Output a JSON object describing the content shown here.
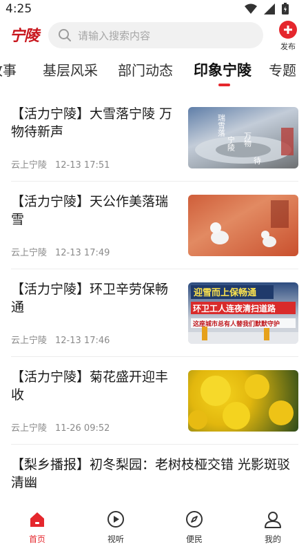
{
  "status_bar": {
    "time": "4:25"
  },
  "header": {
    "logo_text": "宁陵",
    "search_placeholder": "请输入搜索内容",
    "publish_label": "发布"
  },
  "tabs": [
    "故事",
    "基层风采",
    "部门动态",
    "印象宁陵",
    "专题"
  ],
  "active_tab": "印象宁陵",
  "news": [
    {
      "title": "【活力宁陵】大雪落宁陵 万物待新声",
      "source": "云上宁陵",
      "time": "12-13 17:51"
    },
    {
      "title": "【活力宁陵】天公作美落瑞雪",
      "source": "云上宁陵",
      "time": "12-13 17:49"
    },
    {
      "title": "【活力宁陵】环卫辛劳保畅通",
      "source": "云上宁陵",
      "time": "12-13 17:46"
    },
    {
      "title": "【活力宁陵】菊花盛开迎丰收",
      "source": "云上宁陵",
      "time": "11-26 09:52"
    },
    {
      "title": "【梨乡播报】初冬梨园：老树枝桠交错 光影斑驳清幽"
    }
  ],
  "thumb_texts": {
    "t1_a": "瑞雪落",
    "t1_b": "宁陵",
    "t1_c": "万物",
    "t1_d": "待",
    "t3_a": "迎雪而上保畅通",
    "t3_b": "环卫工人连夜清扫道路",
    "t3_c": "这座城市总有人替我们默默守护"
  },
  "bottom_nav": [
    {
      "label": "首页",
      "icon": "home-icon",
      "active": true
    },
    {
      "label": "视听",
      "icon": "play-circle-icon",
      "active": false
    },
    {
      "label": "便民",
      "icon": "compass-icon",
      "active": false
    },
    {
      "label": "我的",
      "icon": "user-icon",
      "active": false
    }
  ],
  "colors": {
    "accent": "#e5272d",
    "logo": "#c8161d"
  }
}
